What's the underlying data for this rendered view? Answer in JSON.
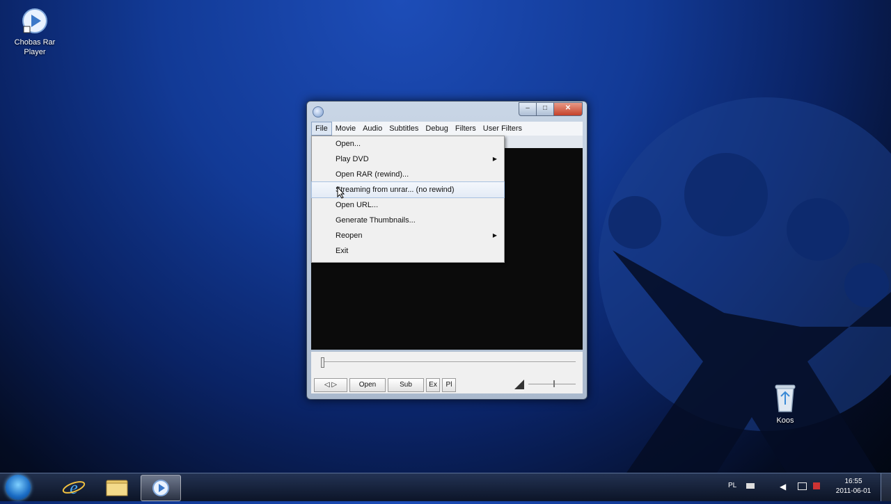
{
  "desktop": {
    "icons": [
      {
        "label": "Chobas Rar Player"
      },
      {
        "label": "Koos"
      }
    ]
  },
  "window": {
    "title": "",
    "controls": {
      "minimize": "–",
      "maximize": "□",
      "close": "✕"
    },
    "menubar": [
      "File",
      "Movie",
      "Audio",
      "Subtitles",
      "Debug",
      "Filters",
      "User Filters"
    ],
    "buttons": {
      "prev": "◁ ▷",
      "open": "Open",
      "sub": "Sub",
      "ex": "Ex",
      "pl": "Pl"
    }
  },
  "file_menu": {
    "items": [
      {
        "label": "Open..."
      },
      {
        "label": "Play DVD",
        "submenu": true
      },
      {
        "label": "Open RAR (rewind)..."
      },
      {
        "label": "Streaming from unrar... (no rewind)"
      },
      {
        "label": "Open URL..."
      },
      {
        "label": "Generate Thumbnails..."
      },
      {
        "label": "Reopen",
        "submenu": true
      },
      {
        "label": "Exit"
      }
    ],
    "submenu_arrow": "▶"
  },
  "taskbar": {
    "tray_lang": "PL",
    "clock_time": "16:55",
    "clock_date": "2011-06-01"
  },
  "colors": {
    "accent": "#123a96",
    "menu_hover": "#dce6f3"
  },
  "icons": [
    "player-icon",
    "recycle-bin-icon",
    "start-orb-icon",
    "ie-icon",
    "folder-icon",
    "speaker-icon"
  ]
}
